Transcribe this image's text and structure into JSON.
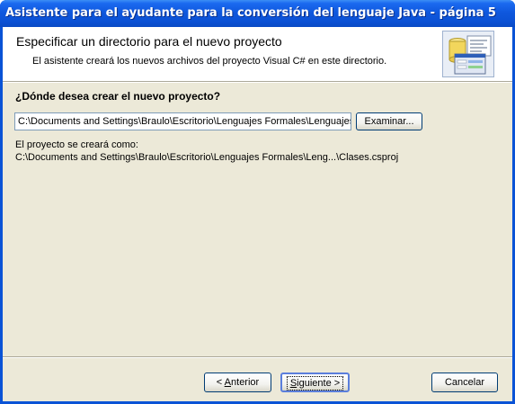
{
  "window": {
    "title": "Asistente para el ayudante para la conversión del lenguaje Java - página 5"
  },
  "header": {
    "title": "Especificar un directorio para el nuevo proyecto",
    "subtitle": "El asistente creará los nuevos archivos del proyecto Visual C# en este directorio.",
    "icon": "wizard-database-icon"
  },
  "form": {
    "question": "¿Dónde desea crear el nuevo proyecto?",
    "path_value": "C:\\Documents and Settings\\Braulo\\Escritorio\\Lenguajes Formales\\Lenguajes F",
    "browse_button": "Examinar...",
    "info_label": "El proyecto se creará como:",
    "info_path": "C:\\Documents and Settings\\Braulo\\Escritorio\\Lenguajes Formales\\Leng...\\Clases.csproj"
  },
  "footer": {
    "back_prefix": "< ",
    "back_key": "A",
    "back_rest": "nterior",
    "next_key": "S",
    "next_rest": "iguiente >",
    "cancel": "Cancelar"
  },
  "colors": {
    "titlebar": "#0a53d6",
    "client": "#ece9d8",
    "button_border": "#003c74"
  }
}
